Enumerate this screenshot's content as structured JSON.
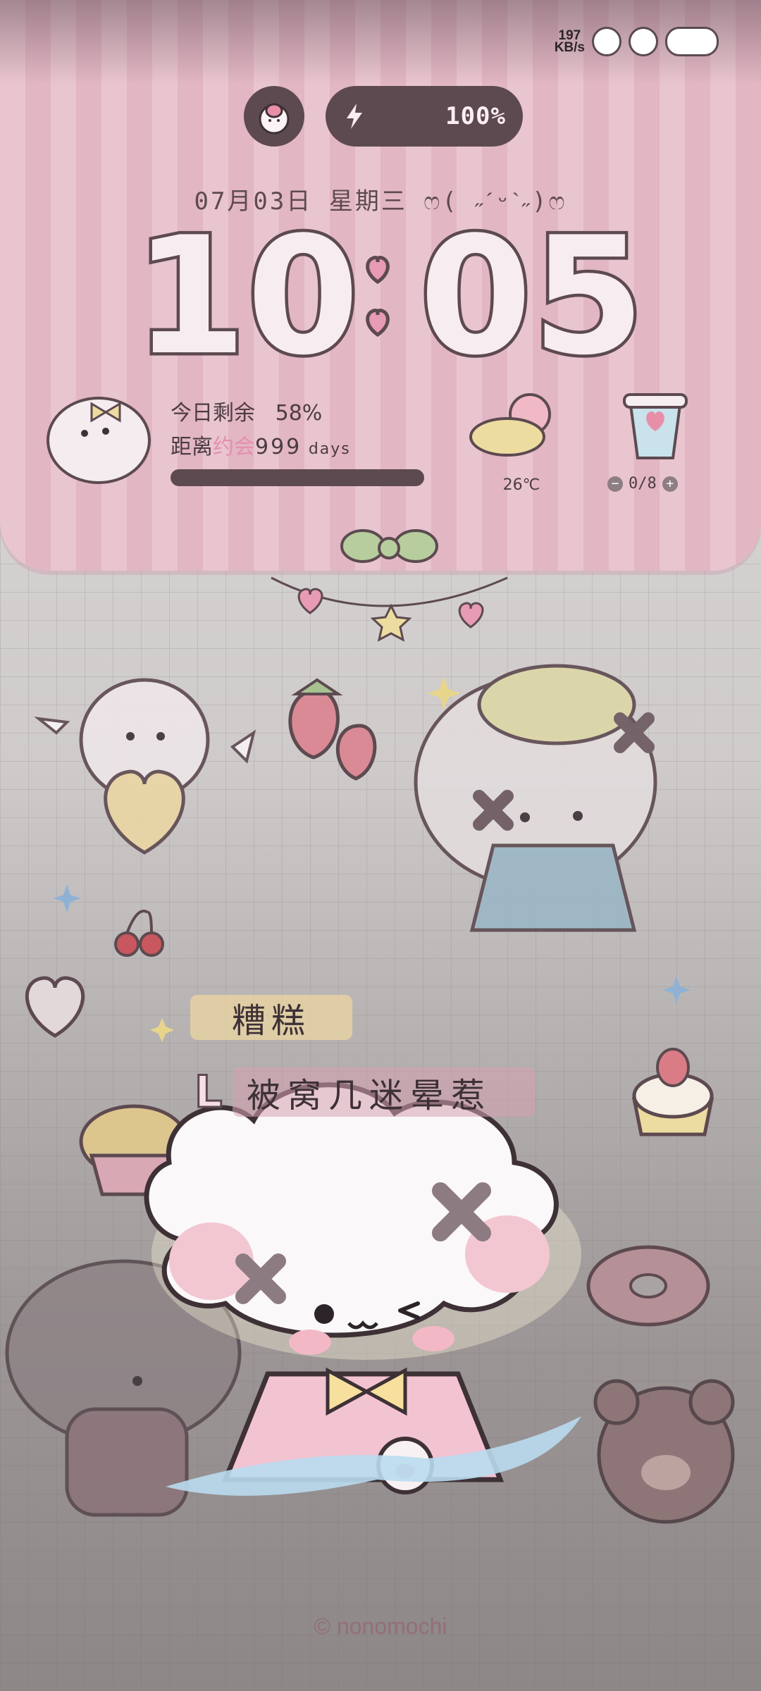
{
  "statusbar": {
    "net_speed_value": "197",
    "net_speed_unit": "KB/s",
    "icons": [
      "rabbit-sticker-icon",
      "cat-sticker-icon",
      "cloud-sticker-icon"
    ]
  },
  "widget": {
    "battery": {
      "percent": "100%",
      "icon": "lightning-icon"
    },
    "date": "07月03日 星期三 ෆ( ˶ˊᵕˋ˶)ෆ",
    "time": {
      "hours": "10",
      "minutes": "05",
      "separator": "heart-colon"
    },
    "countdown": {
      "line1_label": "今日剩余",
      "line1_value": "58%",
      "line2_prefix": "距离",
      "line2_event": "约会",
      "line2_value": "999",
      "line2_unit": "days",
      "progress": 0.58
    },
    "weather": {
      "temperature": "26℃",
      "icon": "cloud-sun-icon"
    },
    "water": {
      "count": "0/8",
      "minus": "−",
      "plus": "+",
      "icon": "bubble-tea-icon"
    }
  },
  "stickers": {
    "label1": "糟糕",
    "label2_mark": "L",
    "label2": "被窝几迷晕惹"
  },
  "copyright": "© nonomochi",
  "colors": {
    "panel_pink": "#e9c5cf",
    "dark": "#5d4a50",
    "accent_pink": "#e58fae"
  }
}
